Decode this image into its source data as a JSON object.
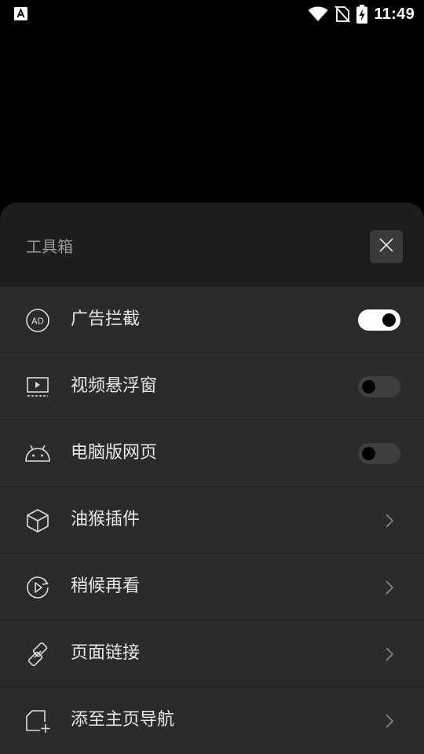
{
  "status_bar": {
    "time": "11:49",
    "left_icon": "a-box-icon",
    "icons": [
      "wifi-icon",
      "no-sim-icon",
      "battery-charging-icon"
    ]
  },
  "toolbox": {
    "title": "工具箱",
    "close_icon": "close-icon",
    "items": [
      {
        "label": "广告拦截",
        "icon": "ad-block-icon",
        "control": "toggle",
        "enabled": true
      },
      {
        "label": "视频悬浮窗",
        "icon": "floating-video-icon",
        "control": "toggle",
        "enabled": false
      },
      {
        "label": "电脑版网页",
        "icon": "android-icon",
        "control": "toggle",
        "enabled": false
      },
      {
        "label": "油猴插件",
        "icon": "cube-icon",
        "control": "chevron"
      },
      {
        "label": "稍候再看",
        "icon": "play-later-icon",
        "control": "chevron"
      },
      {
        "label": "页面链接",
        "icon": "link-icon",
        "control": "chevron"
      },
      {
        "label": "添至主页导航",
        "icon": "add-to-home-icon",
        "control": "chevron"
      }
    ]
  },
  "colors": {
    "background": "#000000",
    "sheet": "#2b2b2b",
    "sheet_header": "#1d1d1d",
    "text_primary": "#e8e8e8",
    "text_secondary": "#9a9a9a",
    "toggle_on": "#ffffff",
    "toggle_off": "#3f3f3f"
  }
}
